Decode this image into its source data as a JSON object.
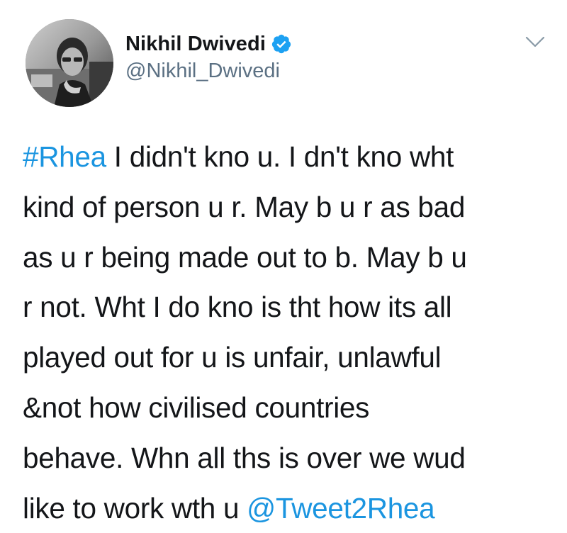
{
  "tweet": {
    "author": {
      "display_name": "Nikhil Dwivedi",
      "handle": "@Nikhil_Dwivedi",
      "verified_icon": "verified-badge-icon",
      "avatar_icon": "profile-photo"
    },
    "menu_icon": "chevron-down-icon",
    "body": {
      "hashtag": "#Rhea",
      "line1_rest": " I didn't kno u. I dn't kno wht",
      "line2": "kind of person u r. May b u r as bad",
      "line3": "as u r being made out to b. May b u",
      "line4": "r not. Wht I do kno is tht how its all",
      "line5": "played out for u is unfair, unlawful",
      "line6": "&not how civilised countries",
      "line7": "behave. Whn all ths is over we wud",
      "line8_start": "like to work wth u ",
      "mention": "@Tweet2Rhea"
    }
  },
  "colors": {
    "link": "#1b95e0",
    "text": "#141619",
    "secondary": "#5b7083",
    "verified": "#1da1f2"
  }
}
